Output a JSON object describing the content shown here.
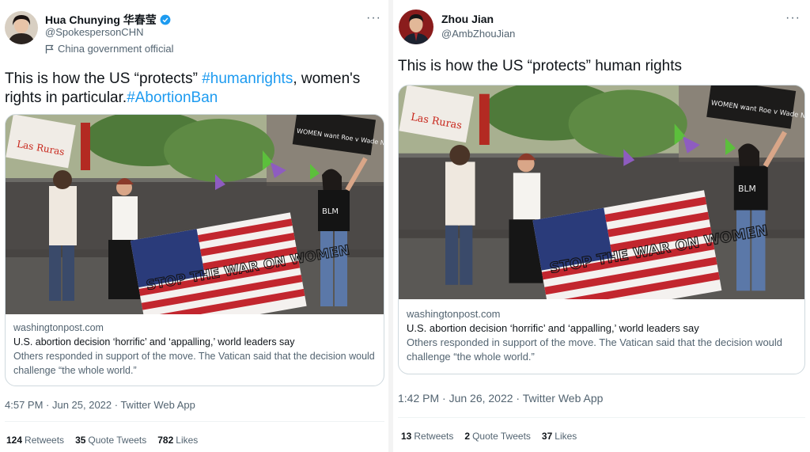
{
  "left": {
    "display_name": "Hua Chunying 华春莹",
    "handle": "@SpokespersonCHN",
    "gov_label": "China government official",
    "more_label": "···",
    "text_before": "This is how the US “protects” ",
    "hashtag_1": "#humanrights",
    "text_middle": ", women's rights in particular.",
    "hashtag_2": "#AbortionBan",
    "card": {
      "domain": "washingtonpost.com",
      "title": "U.S. abortion decision ‘horrific’ and ‘appalling,’ world leaders say",
      "description": "Others responded in support of the move. The Vatican said that the decision would challenge “the whole world.”",
      "sign_left": "Las Ruras",
      "sign_right": "WOMEN want Roe v Wade NOT JESUS",
      "flag_text": "STOP THE WAR ON WOMEN",
      "shirt_text": "BLM"
    },
    "timestamp": "4:57 PM · Jun 25, 2022 · Twitter Web App",
    "retweets_count": "124",
    "retweets_label": "Retweets",
    "quotes_count": "35",
    "quotes_label": "Quote Tweets",
    "likes_count": "782",
    "likes_label": "Likes"
  },
  "right": {
    "display_name": "Zhou Jian",
    "handle": "@AmbZhouJian",
    "more_label": "···",
    "text": "This is how the US “protects” human rights",
    "card": {
      "domain": "washingtonpost.com",
      "title": "U.S. abortion decision ‘horrific’ and ‘appalling,’ world leaders say",
      "description": "Others responded in support of the move. The Vatican said that the decision would challenge “the whole world.”",
      "sign_left": "Las Ruras",
      "sign_right": "WOMEN want Roe v Wade NOT JESUS",
      "flag_text": "STOP THE WAR ON WOMEN",
      "shirt_text": "BLM"
    },
    "timestamp": "1:42 PM · Jun 26, 2022 · Twitter Web App",
    "retweets_count": "13",
    "retweets_label": "Retweets",
    "quotes_count": "2",
    "quotes_label": "Quote Tweets",
    "likes_count": "37",
    "likes_label": "Likes"
  },
  "colors": {
    "link": "#1d9bf0",
    "secondary_text": "#536471",
    "primary_text": "#0f1419",
    "border": "#cfd9de"
  }
}
